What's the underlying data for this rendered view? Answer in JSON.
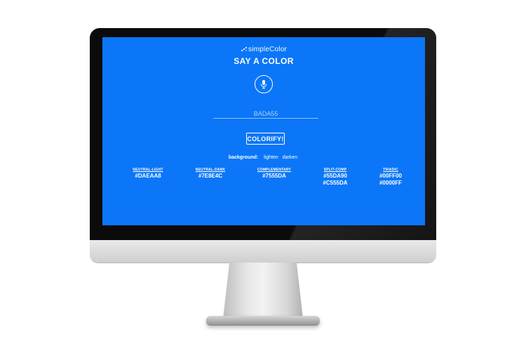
{
  "app": {
    "brand_name": "simpleColor",
    "title": "SAY A COLOR"
  },
  "input": {
    "placeholder": "BADA55"
  },
  "actions": {
    "colorify_label": "COLORIFY!"
  },
  "background": {
    "label": "background:",
    "lighten_label": "lighten",
    "darken_label": "darken"
  },
  "palette": [
    {
      "name": "NEUTRAL-LIGHT",
      "values": [
        "#DAEAA8"
      ]
    },
    {
      "name": "NEUTRAL-DARK",
      "values": [
        "#7E8E4C"
      ]
    },
    {
      "name": "COMPLEMENTARY",
      "values": [
        "#7555DA"
      ]
    },
    {
      "name": "SPLIT-COMP",
      "values": [
        "#55DA90",
        "#C555DA"
      ]
    },
    {
      "name": "TRIADIC",
      "values": [
        "#00FF00",
        "#0000FF"
      ]
    }
  ],
  "colors": {
    "screen_background": "#0B76F7",
    "foreground": "#FFFFFF",
    "monitor_bezel": "#0B0B0B",
    "monitor_chin": "#D9D9D9"
  },
  "icons": {
    "brand": "sparkle-dots-icon",
    "microphone": "microphone-icon"
  }
}
